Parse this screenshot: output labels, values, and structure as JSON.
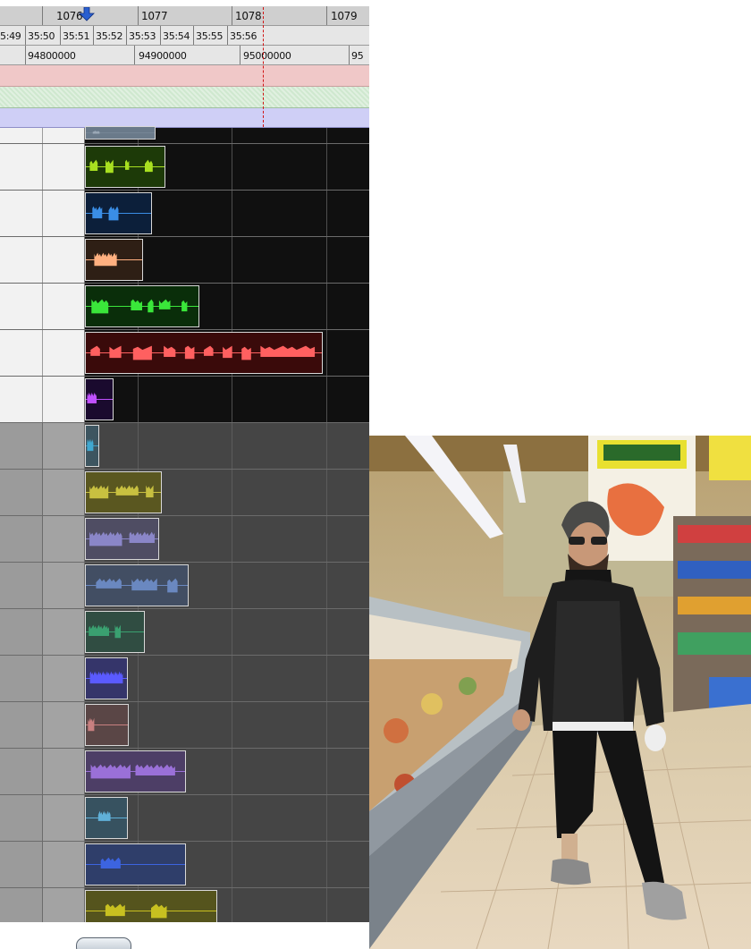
{
  "rulers": {
    "bars": [
      "1076",
      "1077",
      "1078",
      "1079"
    ],
    "timecode": [
      "5:49",
      "35:50",
      "35:51",
      "35:52",
      "35:53",
      "35:54",
      "35:55",
      "35:56"
    ],
    "samples": [
      "94800000",
      "94900000",
      "95000000",
      "95"
    ]
  },
  "colors": {
    "marker_lane": "#f0c8c8",
    "chord_lane": "#cfe8cf",
    "tempo_lane": "#cfcff6",
    "playhead": "#d01414"
  },
  "tracks": [
    {
      "id": "t0",
      "clip_color": "#6a7a8a",
      "wave": "#9aa8b6",
      "dim": false
    },
    {
      "id": "t1",
      "clip_color": "#1d3a08",
      "wave": "#a8e020",
      "dim": false
    },
    {
      "id": "t2",
      "clip_color": "#0c1f3a",
      "wave": "#3a8ee6",
      "dim": false
    },
    {
      "id": "t3",
      "clip_color": "#2e1f15",
      "wave": "#ffb080",
      "dim": false
    },
    {
      "id": "t4",
      "clip_color": "#0a2e0a",
      "wave": "#3ae63a",
      "dim": false
    },
    {
      "id": "t5",
      "clip_color": "#3a0a0a",
      "wave": "#ff6060",
      "dim": false
    },
    {
      "id": "t6",
      "clip_color": "#1a0a2e",
      "wave": "#c050ff",
      "dim": false
    },
    {
      "id": "t7",
      "clip_color": "#3d5560",
      "wave": "#40a8d0",
      "dim": true
    },
    {
      "id": "t8",
      "clip_color": "#5a5720",
      "wave": "#c8c040",
      "dim": true
    },
    {
      "id": "t9",
      "clip_color": "#4f4d63",
      "wave": "#8a86c8",
      "dim": true
    },
    {
      "id": "t10",
      "clip_color": "#424e63",
      "wave": "#6a88c0",
      "dim": true
    },
    {
      "id": "t11",
      "clip_color": "#304d42",
      "wave": "#3aa070",
      "dim": true
    },
    {
      "id": "t12",
      "clip_color": "#35356a",
      "wave": "#5a5aff",
      "dim": true
    },
    {
      "id": "t13",
      "clip_color": "#5a4646",
      "wave": "#c88080",
      "dim": true
    },
    {
      "id": "t14",
      "clip_color": "#4d3e66",
      "wave": "#9a70d8",
      "dim": true
    },
    {
      "id": "t15",
      "clip_color": "#375260",
      "wave": "#60b0d8",
      "dim": true
    },
    {
      "id": "t16",
      "clip_color": "#2f3e6a",
      "wave": "#3c64e0",
      "dim": true
    },
    {
      "id": "t17",
      "clip_color": "#55541d",
      "wave": "#c8c020",
      "dim": true
    }
  ]
}
